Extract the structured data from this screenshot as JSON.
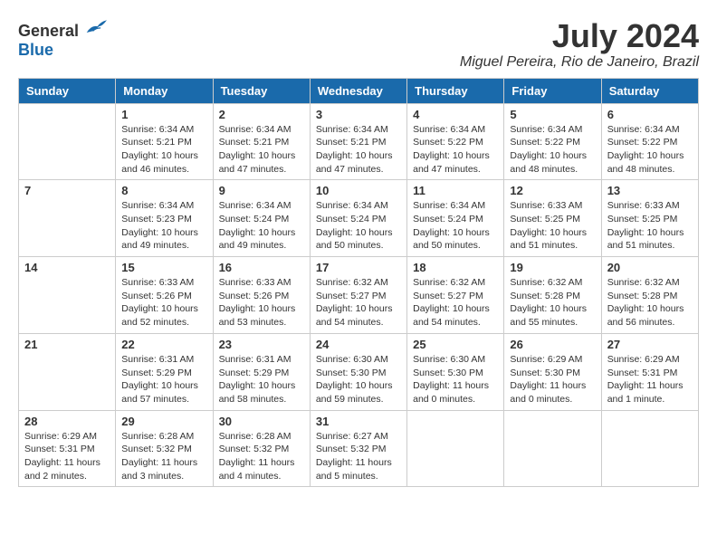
{
  "logo": {
    "general": "General",
    "blue": "Blue"
  },
  "header": {
    "month_year": "July 2024",
    "location": "Miguel Pereira, Rio de Janeiro, Brazil"
  },
  "weekdays": [
    "Sunday",
    "Monday",
    "Tuesday",
    "Wednesday",
    "Thursday",
    "Friday",
    "Saturday"
  ],
  "weeks": [
    [
      {
        "day": "",
        "info": ""
      },
      {
        "day": "1",
        "info": "Sunrise: 6:34 AM\nSunset: 5:21 PM\nDaylight: 10 hours\nand 46 minutes."
      },
      {
        "day": "2",
        "info": "Sunrise: 6:34 AM\nSunset: 5:21 PM\nDaylight: 10 hours\nand 47 minutes."
      },
      {
        "day": "3",
        "info": "Sunrise: 6:34 AM\nSunset: 5:21 PM\nDaylight: 10 hours\nand 47 minutes."
      },
      {
        "day": "4",
        "info": "Sunrise: 6:34 AM\nSunset: 5:22 PM\nDaylight: 10 hours\nand 47 minutes."
      },
      {
        "day": "5",
        "info": "Sunrise: 6:34 AM\nSunset: 5:22 PM\nDaylight: 10 hours\nand 48 minutes."
      },
      {
        "day": "6",
        "info": "Sunrise: 6:34 AM\nSunset: 5:22 PM\nDaylight: 10 hours\nand 48 minutes."
      }
    ],
    [
      {
        "day": "7",
        "info": ""
      },
      {
        "day": "8",
        "info": "Sunrise: 6:34 AM\nSunset: 5:23 PM\nDaylight: 10 hours\nand 49 minutes."
      },
      {
        "day": "9",
        "info": "Sunrise: 6:34 AM\nSunset: 5:24 PM\nDaylight: 10 hours\nand 49 minutes."
      },
      {
        "day": "10",
        "info": "Sunrise: 6:34 AM\nSunset: 5:24 PM\nDaylight: 10 hours\nand 50 minutes."
      },
      {
        "day": "11",
        "info": "Sunrise: 6:34 AM\nSunset: 5:24 PM\nDaylight: 10 hours\nand 50 minutes."
      },
      {
        "day": "12",
        "info": "Sunrise: 6:33 AM\nSunset: 5:25 PM\nDaylight: 10 hours\nand 51 minutes."
      },
      {
        "day": "13",
        "info": "Sunrise: 6:33 AM\nSunset: 5:25 PM\nDaylight: 10 hours\nand 51 minutes."
      }
    ],
    [
      {
        "day": "14",
        "info": ""
      },
      {
        "day": "15",
        "info": "Sunrise: 6:33 AM\nSunset: 5:26 PM\nDaylight: 10 hours\nand 52 minutes."
      },
      {
        "day": "16",
        "info": "Sunrise: 6:33 AM\nSunset: 5:26 PM\nDaylight: 10 hours\nand 53 minutes."
      },
      {
        "day": "17",
        "info": "Sunrise: 6:32 AM\nSunset: 5:27 PM\nDaylight: 10 hours\nand 54 minutes."
      },
      {
        "day": "18",
        "info": "Sunrise: 6:32 AM\nSunset: 5:27 PM\nDaylight: 10 hours\nand 54 minutes."
      },
      {
        "day": "19",
        "info": "Sunrise: 6:32 AM\nSunset: 5:28 PM\nDaylight: 10 hours\nand 55 minutes."
      },
      {
        "day": "20",
        "info": "Sunrise: 6:32 AM\nSunset: 5:28 PM\nDaylight: 10 hours\nand 56 minutes."
      }
    ],
    [
      {
        "day": "21",
        "info": ""
      },
      {
        "day": "22",
        "info": "Sunrise: 6:31 AM\nSunset: 5:29 PM\nDaylight: 10 hours\nand 57 minutes."
      },
      {
        "day": "23",
        "info": "Sunrise: 6:31 AM\nSunset: 5:29 PM\nDaylight: 10 hours\nand 58 minutes."
      },
      {
        "day": "24",
        "info": "Sunrise: 6:30 AM\nSunset: 5:30 PM\nDaylight: 10 hours\nand 59 minutes."
      },
      {
        "day": "25",
        "info": "Sunrise: 6:30 AM\nSunset: 5:30 PM\nDaylight: 11 hours\nand 0 minutes."
      },
      {
        "day": "26",
        "info": "Sunrise: 6:29 AM\nSunset: 5:30 PM\nDaylight: 11 hours\nand 0 minutes."
      },
      {
        "day": "27",
        "info": "Sunrise: 6:29 AM\nSunset: 5:31 PM\nDaylight: 11 hours\nand 1 minute."
      }
    ],
    [
      {
        "day": "28",
        "info": "Sunrise: 6:29 AM\nSunset: 5:31 PM\nDaylight: 11 hours\nand 2 minutes."
      },
      {
        "day": "29",
        "info": "Sunrise: 6:28 AM\nSunset: 5:32 PM\nDaylight: 11 hours\nand 3 minutes."
      },
      {
        "day": "30",
        "info": "Sunrise: 6:28 AM\nSunset: 5:32 PM\nDaylight: 11 hours\nand 4 minutes."
      },
      {
        "day": "31",
        "info": "Sunrise: 6:27 AM\nSunset: 5:32 PM\nDaylight: 11 hours\nand 5 minutes."
      },
      {
        "day": "",
        "info": ""
      },
      {
        "day": "",
        "info": ""
      },
      {
        "day": "",
        "info": ""
      }
    ]
  ]
}
